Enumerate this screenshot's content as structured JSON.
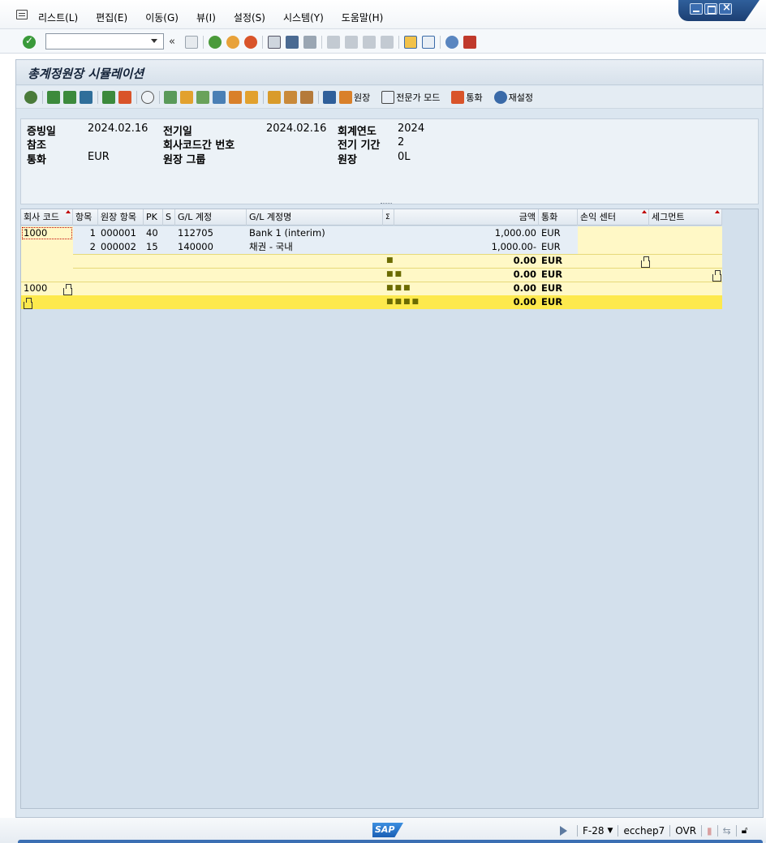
{
  "menubar": {
    "items": [
      "리스트(L)",
      "편집(E)",
      "이동(G)",
      "뷰(I)",
      "설정(S)",
      "시스템(Y)",
      "도움말(H)"
    ]
  },
  "stdbar": {
    "command_value": "",
    "back_symbol": "«"
  },
  "page": {
    "title": "총계정원장 시뮬레이션"
  },
  "app_toolbar": {
    "ledger_label": "원장",
    "expert_mode_label": "전문가 모드",
    "currency_label": "통화",
    "reset_label": "재설정"
  },
  "header": {
    "doc_date_label": "증빙일",
    "doc_date": "2024.02.16",
    "posting_date_label": "전기일",
    "posting_date": "2024.02.16",
    "fiscal_year_label": "회계연도",
    "fiscal_year": "2024",
    "reference_label": "참조",
    "intercompany_label": "회사코드간 번호",
    "period_label": "전기 기간",
    "period": "2",
    "currency_label": "통화",
    "currency": "EUR",
    "ledger_group_label": "원장 그룹",
    "ledger_label": "원장",
    "ledger": "0L"
  },
  "grid": {
    "columns": [
      "회사 코드",
      "항목",
      "원장 항목",
      "PK",
      "S",
      "G/L 계정",
      "G/L 계정명",
      "Σ",
      "금액",
      "통화",
      "손익 센터",
      "세그먼트"
    ],
    "rows": [
      {
        "company": "1000",
        "item": "1",
        "ledger_item": "000001",
        "pk": "40",
        "gl": "112705",
        "gl_name": "Bank 1 (interim)",
        "amount": "1,000.00",
        "currency": "EUR"
      },
      {
        "company": "",
        "item": "2",
        "ledger_item": "000002",
        "pk": "15",
        "gl": "140000",
        "gl_name": "채권 - 국내",
        "amount": "1,000.00-",
        "currency": "EUR"
      }
    ],
    "subtotals": [
      {
        "dots": "■",
        "amount": "0.00",
        "currency": "EUR"
      },
      {
        "dots": "■■",
        "amount": "0.00",
        "currency": "EUR"
      },
      {
        "company": "1000",
        "dots": "■■■",
        "amount": "0.00",
        "currency": "EUR"
      },
      {
        "dots": "■■■■",
        "amount": "0.00",
        "currency": "EUR"
      }
    ]
  },
  "statusbar": {
    "sap_logo": "SAP",
    "transaction": "F-28",
    "system": "ecchep7",
    "mode": "OVR"
  }
}
